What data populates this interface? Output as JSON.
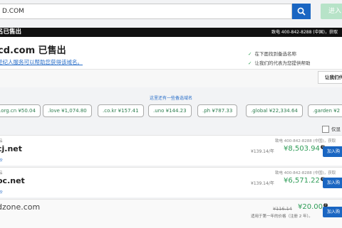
{
  "search": {
    "value": "D.COM",
    "enter_label": "进入"
  },
  "sold_bar": {
    "title": "名已售出",
    "contact": "致电 400-842-8288 (中国)，获取"
  },
  "sold_panel": {
    "domain": "cd.com 已售出",
    "help_link": "经纪人服务可以帮助您获得该域名。",
    "checks": [
      "在下面找到备选名称",
      "让我们的代表为您提供帮助"
    ],
    "agent_button": "让我们代"
  },
  "alternatives": {
    "title": "这里还有一些备选域名",
    "items": [
      ".org.cn ¥50.04",
      ".love ¥1,074.80",
      ".co.kr ¥157.41",
      ".uno ¥144.23",
      ".ph ¥787.33",
      ".global ¥22,334.64",
      ".garden ¥2"
    ]
  },
  "filter": {
    "label": "仅显"
  },
  "listings": [
    {
      "tag": "品",
      "name": "cj.net",
      "sub": "价",
      "contact": "致电 400-842-8288 (中国)，获取",
      "renew": "¥139.14/年",
      "price": "¥8,503.94",
      "add": "加入购"
    },
    {
      "tag": "品",
      "name": "oc.net",
      "sub": "价",
      "contact": "致电 400-842-8288 (中国)，获取",
      "renew": "¥139.14/年",
      "price": "¥6,571.22",
      "add": "加入购"
    },
    {
      "name": "dzone.com",
      "strike": "¥116.14",
      "price": "¥20.00",
      "note": "适用于第一年的价格（注册 2 年）。",
      "add": "加入购"
    }
  ]
}
